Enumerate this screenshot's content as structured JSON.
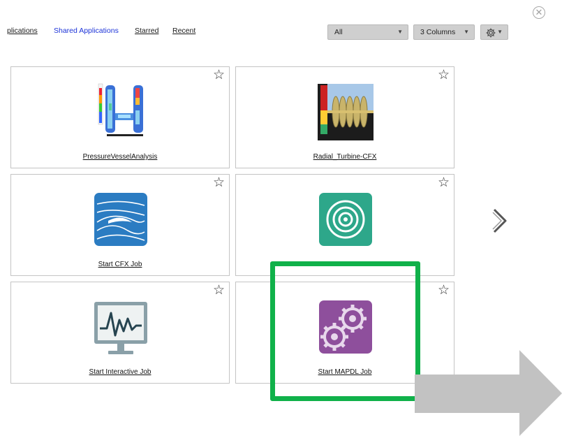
{
  "window": {
    "close_icon": "circle-x-icon"
  },
  "tabs": [
    {
      "label": "plications",
      "active": false
    },
    {
      "label": "Shared Applications",
      "active": true
    },
    {
      "label": "Starred",
      "active": false
    },
    {
      "label": "Recent",
      "active": false
    }
  ],
  "filters": {
    "category": {
      "value": "All"
    },
    "columns": {
      "value": "3 Columns"
    },
    "settings": {
      "icon": "gear-icon"
    }
  },
  "cards": [
    {
      "label": "PressureVesselAnalysis",
      "icon": "pressure-vessel-icon"
    },
    {
      "label": "Radial_Turbine-CFX",
      "icon": "turbine-icon"
    },
    {
      "label": "Start CFX Job",
      "icon": "cfx-icon"
    },
    {
      "label": "",
      "icon": "fluent-icon"
    },
    {
      "label": "Start Interactive Job",
      "icon": "monitor-icon"
    },
    {
      "label": "Start MAPDL Job",
      "icon": "mapdl-gears-icon"
    }
  ],
  "navigation": {
    "next_icon": "chevron-right-icon"
  },
  "annotation": {
    "highlight_color": "#10b14a",
    "arrow_color": "#c2c2c2"
  }
}
